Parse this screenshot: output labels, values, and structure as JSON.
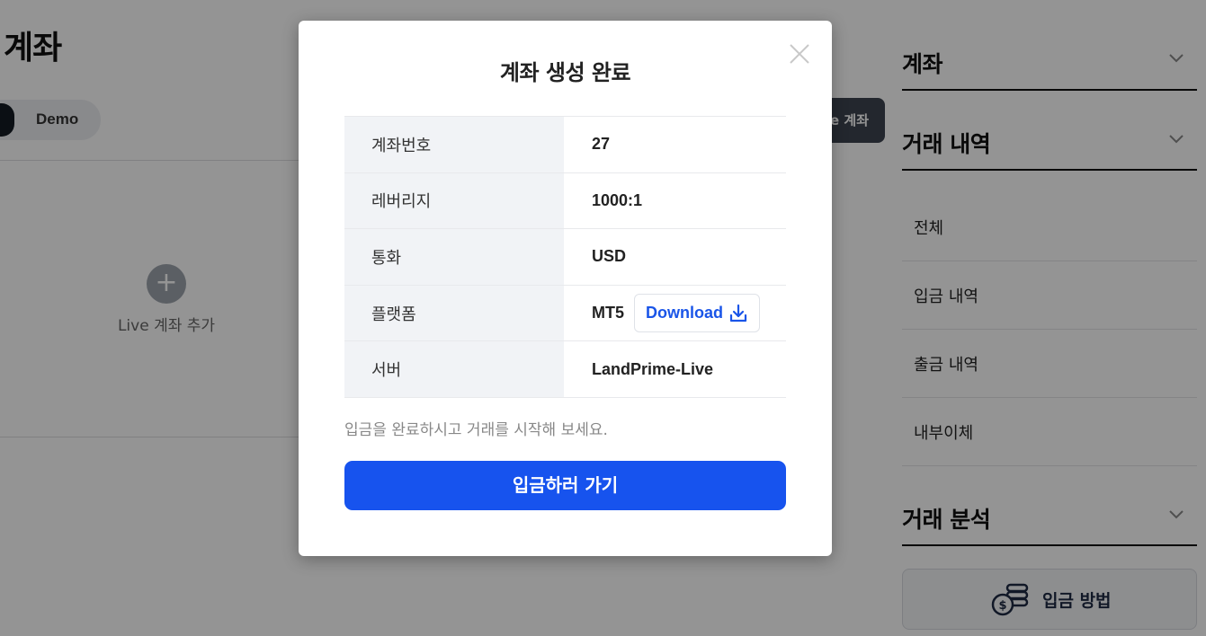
{
  "page": {
    "title": "계좌",
    "tabs": {
      "demo": "Demo"
    },
    "add_live_label": "Live 계좌 추가",
    "add_live_icon": "plus-icon",
    "header_button_label": "e 계좌"
  },
  "sidebar": {
    "sections": [
      {
        "title": "계좌"
      },
      {
        "title": "거래 내역"
      },
      {
        "title": "거래 분석"
      }
    ],
    "history_items": [
      {
        "label": "전체"
      },
      {
        "label": "입금 내역"
      },
      {
        "label": "출금 내역"
      },
      {
        "label": "내부이체"
      }
    ],
    "deposit_method": {
      "label": "입금 방법",
      "icon": "coins-dollar-icon"
    }
  },
  "modal": {
    "title": "계좌 생성 완료",
    "close_icon": "close-icon",
    "rows": [
      {
        "key": "계좌번호",
        "value": "27"
      },
      {
        "key": "레버리지",
        "value": "1000:1"
      },
      {
        "key": "통화",
        "value": "USD"
      },
      {
        "key": "플랫폼",
        "value": "MT5"
      },
      {
        "key": "서버",
        "value": "LandPrime-Live"
      }
    ],
    "download_label": "Download",
    "download_icon": "download-icon",
    "note": "입금을 완료하시고 거래를 시작해 보세요.",
    "primary_button": "입금하러 가기"
  },
  "colors": {
    "primary": "#1753ee",
    "link": "#1a55e8",
    "key_bg": "#f1f3f6",
    "overlay": "rgba(0,0,0,0.42)"
  }
}
